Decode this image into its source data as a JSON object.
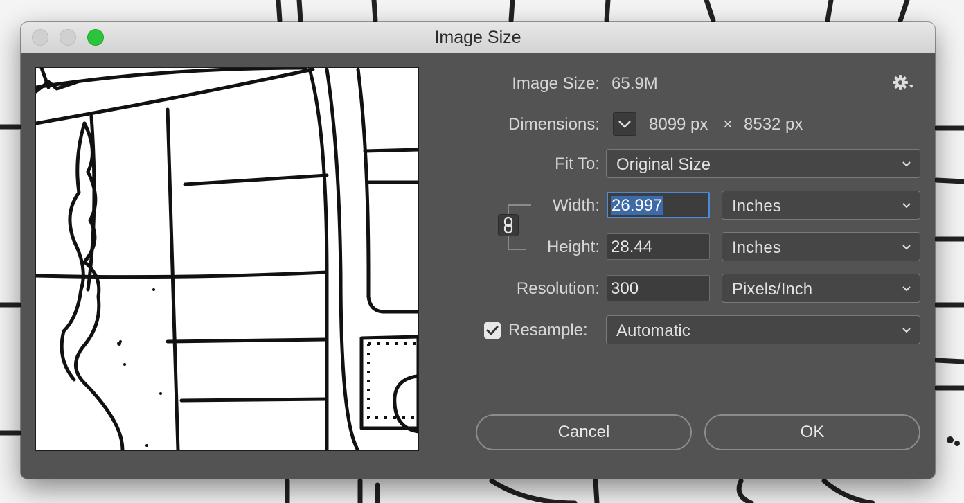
{
  "window": {
    "title": "Image Size"
  },
  "info": {
    "image_size_label": "Image Size:",
    "image_size_value": "65.9M",
    "dimensions_label": "Dimensions:",
    "dim_width": "8099 px",
    "dim_sep": "×",
    "dim_height": "8532 px"
  },
  "fit_to": {
    "label": "Fit To:",
    "value": "Original Size"
  },
  "width": {
    "label": "Width:",
    "value": "26.997",
    "unit": "Inches"
  },
  "height": {
    "label": "Height:",
    "value": "28.44",
    "unit": "Inches"
  },
  "resolution": {
    "label": "Resolution:",
    "value": "300",
    "unit": "Pixels/Inch"
  },
  "resample": {
    "label": "Resample:",
    "checked": true,
    "value": "Automatic"
  },
  "buttons": {
    "cancel": "Cancel",
    "ok": "OK"
  },
  "colors": {
    "dialog_bg": "#535353",
    "focus_ring": "#4d8ad8",
    "zoom_button": "#2bc43d"
  },
  "icons": [
    "gear-icon",
    "chevron-down-icon",
    "chain-link-icon",
    "checkmark-icon"
  ]
}
